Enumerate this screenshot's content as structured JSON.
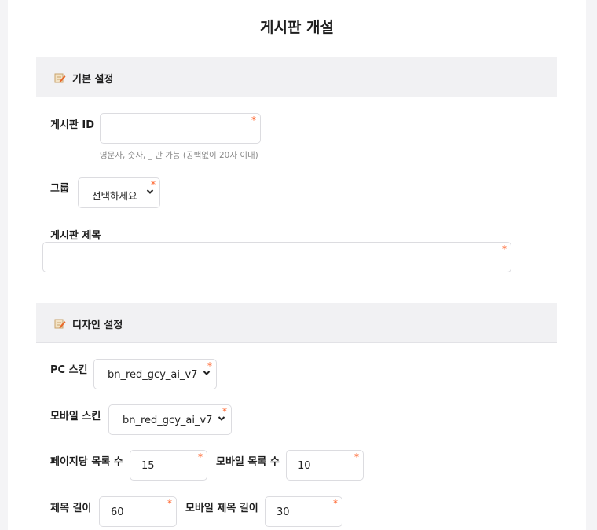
{
  "page_title": "게시판 개설",
  "sections": {
    "basic": {
      "title": "기본 설정",
      "icon": "edit-note-icon",
      "board_id": {
        "label": "게시판 ID",
        "value": "",
        "help": "영문자, 숫자, _ 만 가능 (공백없이 20자 이내)"
      },
      "group": {
        "label": "그룹",
        "selected": "선택하세요"
      },
      "board_title": {
        "label": "게시판 제목",
        "value": ""
      }
    },
    "design": {
      "title": "디자인 설정",
      "icon": "edit-note-icon",
      "pc_skin": {
        "label": "PC 스킨",
        "selected": "bn_red_gcy_ai_v7"
      },
      "mobile_skin": {
        "label": "모바일 스킨",
        "selected": "bn_red_gcy_ai_v7"
      },
      "page_rows": {
        "label": "페이지당 목록 수",
        "value": "15"
      },
      "mobile_page_rows": {
        "label": "모바일 목록 수",
        "value": "10"
      },
      "subject_len": {
        "label": "제목 길이",
        "value": "60"
      },
      "mobile_subject_len": {
        "label": "모바일 제목 길이",
        "value": "30"
      }
    }
  },
  "required_mark": "*",
  "colors": {
    "required": "#ff5a1f",
    "section_bg": "#f1f1f3",
    "page_bg": "#f4f4f6"
  }
}
